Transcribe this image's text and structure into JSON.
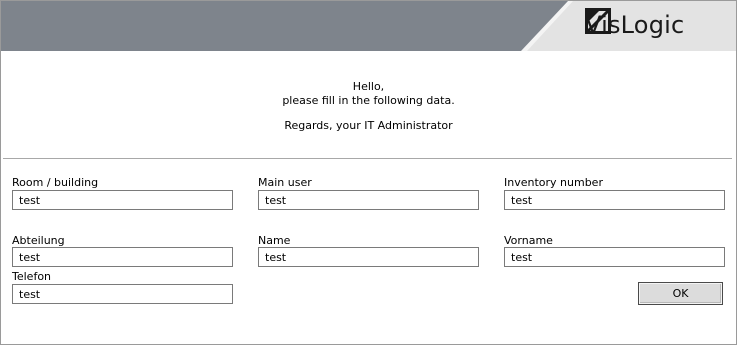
{
  "brand": {
    "name": "VisLogic",
    "logo_icon": "vislogic-logo-icon"
  },
  "colors": {
    "banner_dark": "#7e848c",
    "banner_light": "#e3e3e3"
  },
  "message": {
    "greeting": "Hello,",
    "instruction": "please fill in the following data.",
    "signature": "Regards, your IT Administrator"
  },
  "fields": {
    "room": {
      "label": "Room / building",
      "value": "test"
    },
    "main_user": {
      "label": "Main user",
      "value": "test"
    },
    "inventory": {
      "label": "Inventory number",
      "value": "test"
    },
    "abteilung": {
      "label": "Abteilung",
      "value": "test"
    },
    "name": {
      "label": "Name",
      "value": "test"
    },
    "vorname": {
      "label": "Vorname",
      "value": "test"
    },
    "telefon": {
      "label": "Telefon",
      "value": "test"
    }
  },
  "actions": {
    "ok_label": "OK"
  }
}
